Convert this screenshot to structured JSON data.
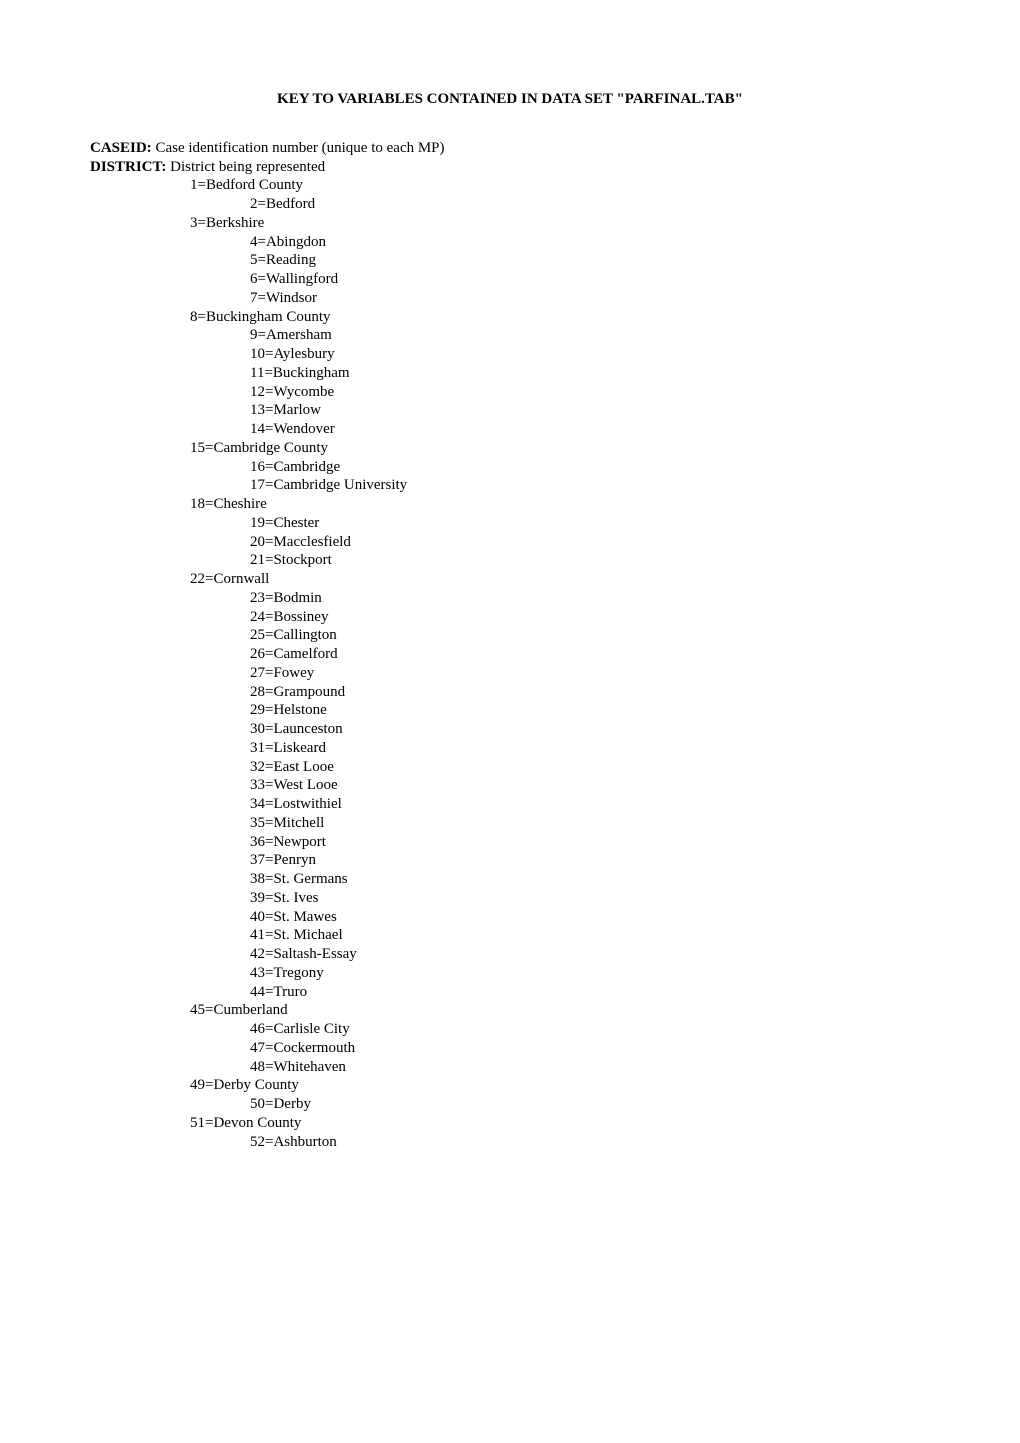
{
  "title": "KEY TO VARIABLES CONTAINED IN DATA SET \"PARFINAL.TAB\"",
  "vars": {
    "caseid": {
      "label": "CASEID:",
      "desc": " Case identification number (unique to each MP)"
    },
    "district": {
      "label": "DISTRICT:",
      "desc": " District being represented"
    }
  },
  "districts": [
    {
      "level": 1,
      "text": "1=Bedford County"
    },
    {
      "level": 2,
      "text": "2=Bedford"
    },
    {
      "level": 1,
      "text": "3=Berkshire"
    },
    {
      "level": 2,
      "text": "4=Abingdon"
    },
    {
      "level": 2,
      "text": "5=Reading"
    },
    {
      "level": 2,
      "text": "6=Wallingford"
    },
    {
      "level": 2,
      "text": "7=Windsor"
    },
    {
      "level": 1,
      "text": "8=Buckingham County"
    },
    {
      "level": 2,
      "text": "9=Amersham"
    },
    {
      "level": 2,
      "text": "10=Aylesbury"
    },
    {
      "level": 2,
      "text": "11=Buckingham"
    },
    {
      "level": 2,
      "text": "12=Wycombe"
    },
    {
      "level": 2,
      "text": "13=Marlow"
    },
    {
      "level": 2,
      "text": "14=Wendover"
    },
    {
      "level": 1,
      "text": "15=Cambridge County"
    },
    {
      "level": 2,
      "text": "16=Cambridge"
    },
    {
      "level": 2,
      "text": "17=Cambridge University"
    },
    {
      "level": 1,
      "text": "18=Cheshire"
    },
    {
      "level": 2,
      "text": "19=Chester"
    },
    {
      "level": 2,
      "text": "20=Macclesfield"
    },
    {
      "level": 2,
      "text": "21=Stockport"
    },
    {
      "level": 1,
      "text": "22=Cornwall"
    },
    {
      "level": 2,
      "text": "23=Bodmin"
    },
    {
      "level": 2,
      "text": "24=Bossiney"
    },
    {
      "level": 2,
      "text": "25=Callington"
    },
    {
      "level": 2,
      "text": "26=Camelford"
    },
    {
      "level": 2,
      "text": "27=Fowey"
    },
    {
      "level": 2,
      "text": "28=Grampound"
    },
    {
      "level": 2,
      "text": "29=Helstone"
    },
    {
      "level": 2,
      "text": "30=Launceston"
    },
    {
      "level": 2,
      "text": "31=Liskeard"
    },
    {
      "level": 2,
      "text": "32=East Looe"
    },
    {
      "level": 2,
      "text": "33=West Looe"
    },
    {
      "level": 2,
      "text": "34=Lostwithiel"
    },
    {
      "level": 2,
      "text": "35=Mitchell"
    },
    {
      "level": 2,
      "text": "36=Newport"
    },
    {
      "level": 2,
      "text": "37=Penryn"
    },
    {
      "level": 2,
      "text": "38=St. Germans"
    },
    {
      "level": 2,
      "text": "39=St. Ives"
    },
    {
      "level": 2,
      "text": "40=St. Mawes"
    },
    {
      "level": 2,
      "text": "41=St. Michael"
    },
    {
      "level": 2,
      "text": "42=Saltash-Essay"
    },
    {
      "level": 2,
      "text": "43=Tregony"
    },
    {
      "level": 2,
      "text": "44=Truro"
    },
    {
      "level": 1,
      "text": "45=Cumberland"
    },
    {
      "level": 2,
      "text": "46=Carlisle City"
    },
    {
      "level": 2,
      "text": "47=Cockermouth"
    },
    {
      "level": 2,
      "text": "48=Whitehaven"
    },
    {
      "level": 1,
      "text": "49=Derby County"
    },
    {
      "level": 2,
      "text": "50=Derby"
    },
    {
      "level": 1,
      "text": "51=Devon County"
    },
    {
      "level": 2,
      "text": "52=Ashburton"
    }
  ]
}
